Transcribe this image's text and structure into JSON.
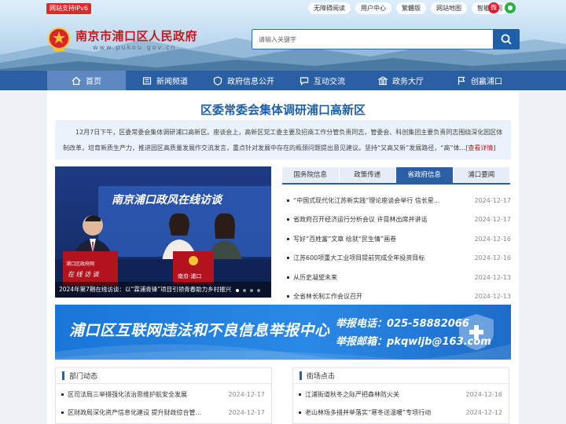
{
  "header": {
    "ipv6_badge": "网站支持IPv6",
    "toplinks": [
      "无障碍阅读",
      "用户中心",
      "繁體版",
      "网站地图",
      "智能答问"
    ],
    "social": {
      "weibo_icon": "weibo-icon",
      "wechat_icon": "wechat-icon"
    },
    "site_title": "南京市浦口区人民政府",
    "site_domain": "www.pukou.gov.cn",
    "search": {
      "placeholder": "请输入关键字",
      "value": ""
    }
  },
  "nav": {
    "items": [
      {
        "label": "首页",
        "icon": "home-icon",
        "active": true
      },
      {
        "label": "新闻频道",
        "icon": "news-icon"
      },
      {
        "label": "政府信息公开",
        "icon": "info-icon"
      },
      {
        "label": "互动交流",
        "icon": "chat-icon"
      },
      {
        "label": "政务大厅",
        "icon": "hall-icon"
      },
      {
        "label": "创赢浦口",
        "icon": "flag-icon"
      }
    ]
  },
  "headline": {
    "title": "区委常委会集体调研浦口高新区",
    "summary": "12月7日下午，区委常委会集体调研浦口高新区。座谈会上，高新区党工委主要及招商工作分管负责同志，管委会、科创集团主要负责同志围绕深化园区体制改革，培育新质生产力，推进园区高质量发展作交流发言，重点针对发展中存在的瓶颈问题提出意见建议。坚持“又高又新”发展路径，“高”体...",
    "more_label": "[查看详情]"
  },
  "slider": {
    "caption": "2024年第7期在线访谈：以“霖浦青锋”项目引领青春助力乡村振兴",
    "screen_text": "南京浦口政风在线访谈",
    "desk_sign": "浦口区政府网 在线访谈",
    "desk_sign_right": "南京·浦口",
    "active_dot": 0,
    "dot_count": 4
  },
  "tabs": {
    "items": [
      "国务院信息",
      "政策传递",
      "省政府信息",
      "浦口要闻"
    ],
    "active_index": 2
  },
  "news": [
    {
      "title": "“中国式现代化江苏新实践”理论座谈会举行 信长星...",
      "date": "2024-12-17"
    },
    {
      "title": "省政府召开经济运行分析会议 许昆林出席并讲话",
      "date": "2024-12-17"
    },
    {
      "title": "写好“百姓富”文章 绘就“民生情”画卷",
      "date": "2024-12-16"
    },
    {
      "title": "江苏600项重大工业项目提前完成全年投资目标",
      "date": "2024-12-16"
    },
    {
      "title": "从历史凝望未来",
      "date": "2024-12-13"
    },
    {
      "title": "全省林长制工作会议召开",
      "date": "2024-12-13"
    }
  ],
  "banner": {
    "title": "浦口区互联网违法和不良信息举报中心",
    "phone_line": "举报电话：025-58882066",
    "email_line": "举报邮箱：pkqwljb@163.com"
  },
  "columns": {
    "left": {
      "title": "部门动态",
      "items": [
        {
          "title": "区司法局三举措强化法治思维护航安全发展",
          "date": "2024-12-17"
        },
        {
          "title": "区财政局深化资产信息化建设 提升财政综合管...",
          "date": "2024-12-17"
        }
      ]
    },
    "right": {
      "title": "街场点击",
      "items": [
        {
          "title": "江浦街道秋冬之际严把森林防火关",
          "date": "2024-12-16"
        },
        {
          "title": "老山林场多措并举落实“寒冬送温暖”专项行动",
          "date": "2024-12-12"
        }
      ]
    }
  },
  "colors": {
    "brand_blue": "#2b5fa3",
    "title_red": "#c8161d",
    "headline_blue": "#1f5fa8"
  }
}
